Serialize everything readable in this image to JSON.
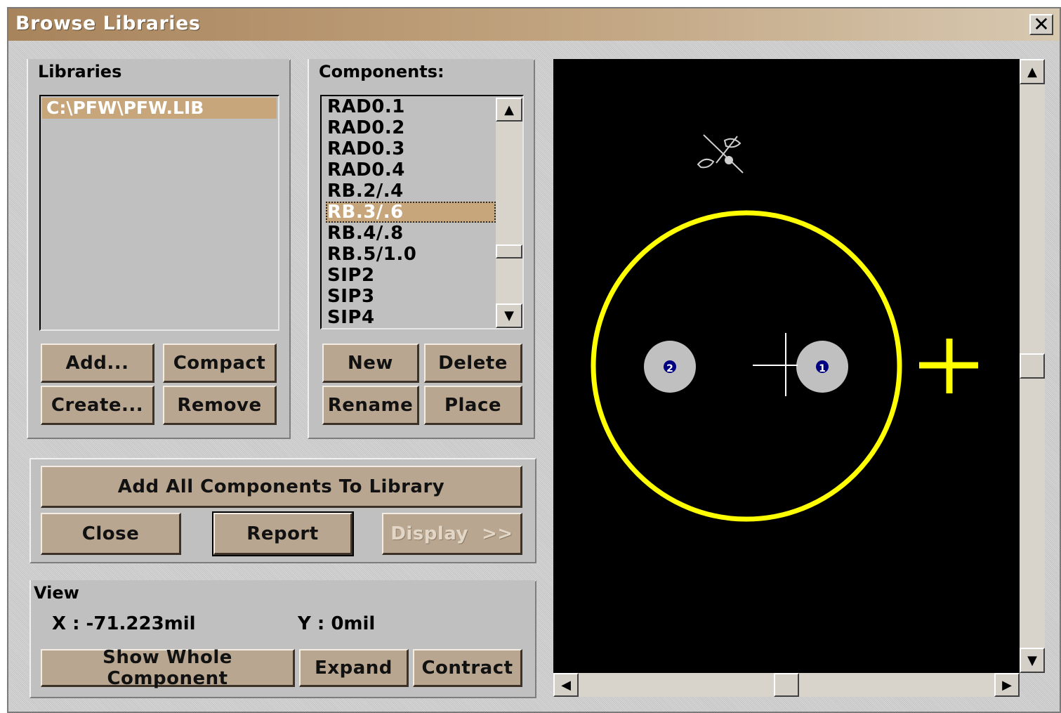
{
  "window": {
    "title": "Browse Libraries",
    "close_label": "✕"
  },
  "libraries": {
    "heading": "Libraries",
    "items": [
      "C:\\PFW\\PFW.LIB"
    ],
    "buttons": {
      "add": "Add...",
      "compact": "Compact",
      "create": "Create...",
      "remove": "Remove"
    }
  },
  "components": {
    "heading": "Components:",
    "items": [
      "RAD0.1",
      "RAD0.2",
      "RAD0.3",
      "RAD0.4",
      "RB.2/.4",
      "RB.3/.6",
      "RB.4/.8",
      "RB.5/1.0",
      "SIP2",
      "SIP3",
      "SIP4"
    ],
    "selected": "RB.3/.6",
    "buttons": {
      "new": "New",
      "delete": "Delete",
      "rename": "Rename",
      "place": "Place"
    }
  },
  "actions": {
    "add_all": "Add All Components To Library",
    "close": "Close",
    "report": "Report",
    "display": "Display  >>"
  },
  "view": {
    "heading": "View",
    "x_readout": "X : -71.223mil",
    "y_readout": "Y : 0mil",
    "show_whole": "Show Whole Component",
    "expand": "Expand",
    "contract": "Contract"
  },
  "preview": {
    "pad_labels": [
      "2",
      "1"
    ],
    "colors": {
      "background": "#000000",
      "outline": "#ffff00",
      "pad": "#c0c0c0",
      "hole": "#000080",
      "cursor": "#ffffff"
    }
  },
  "icons": {
    "scroll_up": "▲",
    "scroll_down": "▼",
    "scroll_left": "◀",
    "scroll_right": "▶"
  }
}
